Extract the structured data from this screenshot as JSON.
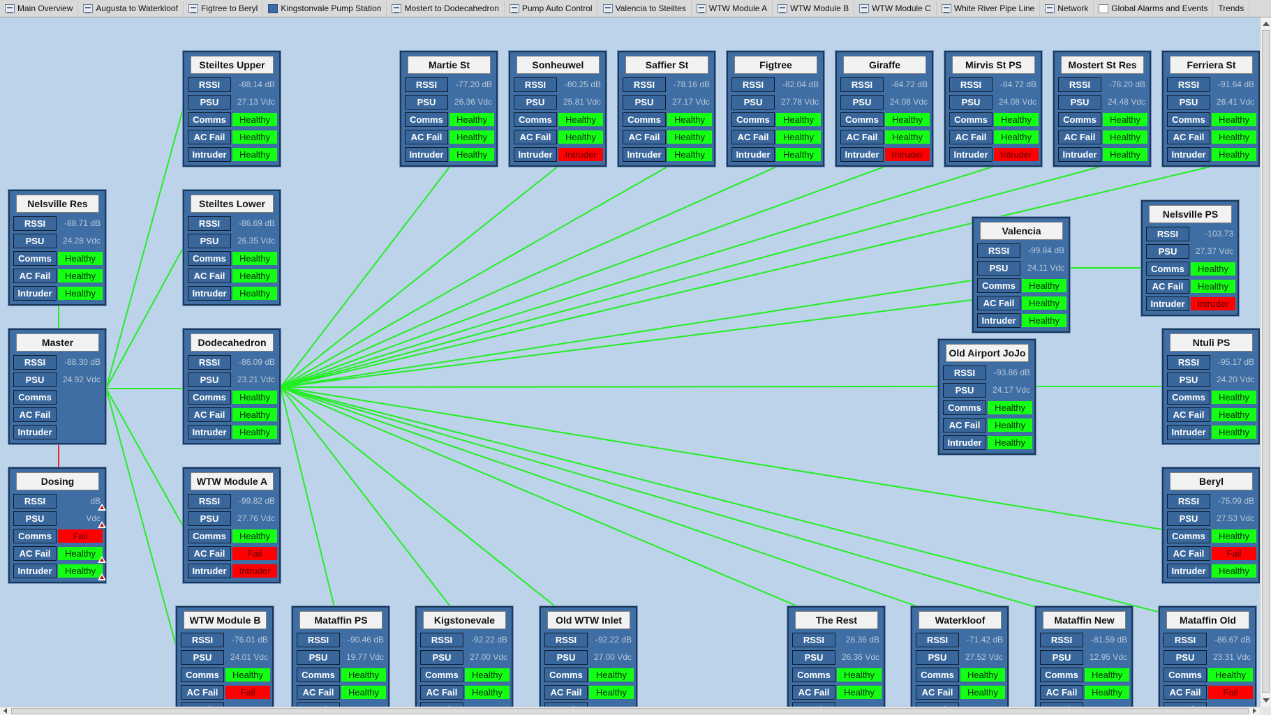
{
  "tabs": [
    {
      "label": "Main Overview",
      "icon": "grid-icon"
    },
    {
      "label": "Augusta to Waterkloof",
      "icon": "grid-icon"
    },
    {
      "label": "Figtree to Beryl",
      "icon": "grid-icon"
    },
    {
      "label": "Kingstonvale Pump Station",
      "icon": "solid-square-icon"
    },
    {
      "label": "Mostert to Dodecahedron",
      "icon": "grid-icon"
    },
    {
      "label": "Pump Auto Control",
      "icon": "grid-icon"
    },
    {
      "label": "Valencia to Steiltes",
      "icon": "grid-icon"
    },
    {
      "label": "WTW Module A",
      "icon": "grid-icon"
    },
    {
      "label": "WTW Module B",
      "icon": "grid-icon"
    },
    {
      "label": "WTW Module C",
      "icon": "grid-icon"
    },
    {
      "label": "White River Pipe Line",
      "icon": "grid-icon"
    },
    {
      "label": "Network",
      "icon": "grid-icon"
    },
    {
      "label": "Global Alarms and Events",
      "icon": "white-square-icon"
    },
    {
      "label": "Trends",
      "icon": ""
    }
  ],
  "row_labels": {
    "rssi": "RSSI",
    "psu": "PSU",
    "comms": "Comms",
    "acfail": "AC Fail",
    "intruder": "Intruder"
  },
  "colors": {
    "healthy": "#14ff14",
    "alarm": "#ff0000",
    "link_ok": "#22ee22",
    "link_fault": "#ee2222",
    "panel": "#3f6ea4"
  },
  "stations": [
    {
      "id": "steiltes-upper",
      "title": "Steiltes Upper",
      "rssi": "-88.14 dB",
      "psu": "27.13 Vdc",
      "comms": "Healthy",
      "acfail": "Healthy",
      "intruder": "Healthy"
    },
    {
      "id": "steiltes-lower",
      "title": "Steiltes Lower",
      "rssi": "-86.69 dB",
      "psu": "26.35 Vdc",
      "comms": "Healthy",
      "acfail": "Healthy",
      "intruder": "Healthy"
    },
    {
      "id": "nelsville-res",
      "title": "Nelsville Res",
      "rssi": "-88.71 dB",
      "psu": "24.28 Vdc",
      "comms": "Healthy",
      "acfail": "Healthy",
      "intruder": "Healthy"
    },
    {
      "id": "master",
      "title": "Master",
      "rssi": "-88.30 dB",
      "psu": "24.92 Vdc",
      "comms": "",
      "acfail": "",
      "intruder": ""
    },
    {
      "id": "dosing",
      "title": "Dosing",
      "rssi": "dB",
      "psu": "Vdc",
      "comms": "Fail",
      "acfail": "Healthy",
      "intruder": "Healthy",
      "warn": [
        "rssi",
        "psu",
        "acfail",
        "intruder"
      ]
    },
    {
      "id": "dodecahedron",
      "title": "Dodecahedron",
      "rssi": "-86.09 dB",
      "psu": "23.21 Vdc",
      "comms": "Healthy",
      "acfail": "Healthy",
      "intruder": "Healthy"
    },
    {
      "id": "wtw-module-a",
      "title": "WTW Module A",
      "rssi": "-99.82 dB",
      "psu": "27.76 Vdc",
      "comms": "Healthy",
      "acfail": "Fail",
      "intruder": "Intruder"
    },
    {
      "id": "martie-st",
      "title": "Martie St",
      "rssi": "-77.20 dB",
      "psu": "26.36 Vdc",
      "comms": "Healthy",
      "acfail": "Healthy",
      "intruder": "Healthy"
    },
    {
      "id": "sonheuwel",
      "title": "Sonheuwel",
      "rssi": "-80.25 dB",
      "psu": "25.81 Vdc",
      "comms": "Healthy",
      "acfail": "Healthy",
      "intruder": "Intruder"
    },
    {
      "id": "saffier-st",
      "title": "Saffier St",
      "rssi": "-78.16 dB",
      "psu": "27.17 Vdc",
      "comms": "Healthy",
      "acfail": "Healthy",
      "intruder": "Healthy"
    },
    {
      "id": "figtree",
      "title": "Figtree",
      "rssi": "-82.04 dB",
      "psu": "27.78 Vdc",
      "comms": "Healthy",
      "acfail": "Healthy",
      "intruder": "Healthy"
    },
    {
      "id": "giraffe",
      "title": "Giraffe",
      "rssi": "-84.72 dB",
      "psu": "24.08 Vdc",
      "comms": "Healthy",
      "acfail": "Healthy",
      "intruder": "Intruder"
    },
    {
      "id": "mirvis-st-ps",
      "title": "Mirvis St PS",
      "rssi": "-84.72 dB",
      "psu": "24.08 Vdc",
      "comms": "Healthy",
      "acfail": "Healthy",
      "intruder": "Intruder"
    },
    {
      "id": "mostert-st-res",
      "title": "Mostert St Res",
      "rssi": "-78.20 dB",
      "psu": "24.48 Vdc",
      "comms": "Healthy",
      "acfail": "Healthy",
      "intruder": "Healthy"
    },
    {
      "id": "ferriera-st",
      "title": "Ferriera St",
      "rssi": "-91.64 dB",
      "psu": "26.41 Vdc",
      "comms": "Healthy",
      "acfail": "Healthy",
      "intruder": "Healthy"
    },
    {
      "id": "valencia",
      "title": "Valencia",
      "rssi": "-99.84 dB",
      "psu": "24.11 Vdc",
      "comms": "Healthy",
      "acfail": "Healthy",
      "intruder": "Healthy"
    },
    {
      "id": "nelsville-ps",
      "title": "Nelsville PS",
      "rssi": "-103.73",
      "psu": "27.37 Vdc",
      "comms": "Healthy",
      "acfail": "Healthy",
      "intruder": "Intruder"
    },
    {
      "id": "old-airport-jojo",
      "title": "Old Airport JoJo",
      "rssi": "-93.86 dB",
      "psu": "24.17 Vdc",
      "comms": "Healthy",
      "acfail": "Healthy",
      "intruder": "Healthy"
    },
    {
      "id": "ntuli-ps",
      "title": "Ntuli PS",
      "rssi": "-95.17 dB",
      "psu": "24.20 Vdc",
      "comms": "Healthy",
      "acfail": "Healthy",
      "intruder": "Healthy"
    },
    {
      "id": "beryl",
      "title": "Beryl",
      "rssi": "-75.09 dB",
      "psu": "27.53 Vdc",
      "comms": "Healthy",
      "acfail": "Fail",
      "intruder": "Healthy"
    },
    {
      "id": "wtw-module-b",
      "title": "WTW Module B",
      "rssi": "-76.01 dB",
      "psu": "24.01 Vdc",
      "comms": "Healthy",
      "acfail": "Fail",
      "intruder": ""
    },
    {
      "id": "mataffin-ps",
      "title": "Mataffin PS",
      "rssi": "-90.46 dB",
      "psu": "19.77 Vdc",
      "comms": "Healthy",
      "acfail": "Healthy",
      "intruder": ""
    },
    {
      "id": "kigstonevale",
      "title": "Kigstonevale",
      "rssi": "-92.22 dB",
      "psu": "27.00 Vdc",
      "comms": "Healthy",
      "acfail": "Healthy",
      "intruder": ""
    },
    {
      "id": "old-wtw-inlet",
      "title": "Old WTW Inlet",
      "rssi": "-92.22 dB",
      "psu": "27.00 Vdc",
      "comms": "Healthy",
      "acfail": "Healthy",
      "intruder": ""
    },
    {
      "id": "the-rest",
      "title": "The Rest",
      "rssi": "26.36 dB",
      "psu": "26.36 Vdc",
      "comms": "Healthy",
      "acfail": "Healthy",
      "intruder": ""
    },
    {
      "id": "waterkloof",
      "title": "Waterkloof",
      "rssi": "-71.42 dB",
      "psu": "27.52 Vdc",
      "comms": "Healthy",
      "acfail": "Healthy",
      "intruder": ""
    },
    {
      "id": "mataffin-new",
      "title": "Mataffin New",
      "rssi": "-81.59 dB",
      "psu": "12.95 Vdc",
      "comms": "Healthy",
      "acfail": "Healthy",
      "intruder": ""
    },
    {
      "id": "mataffin-old",
      "title": "Mataffin Old",
      "rssi": "-86.67 dB",
      "psu": "23.31 Vdc",
      "comms": "Healthy",
      "acfail": "Fail",
      "intruder": ""
    }
  ]
}
